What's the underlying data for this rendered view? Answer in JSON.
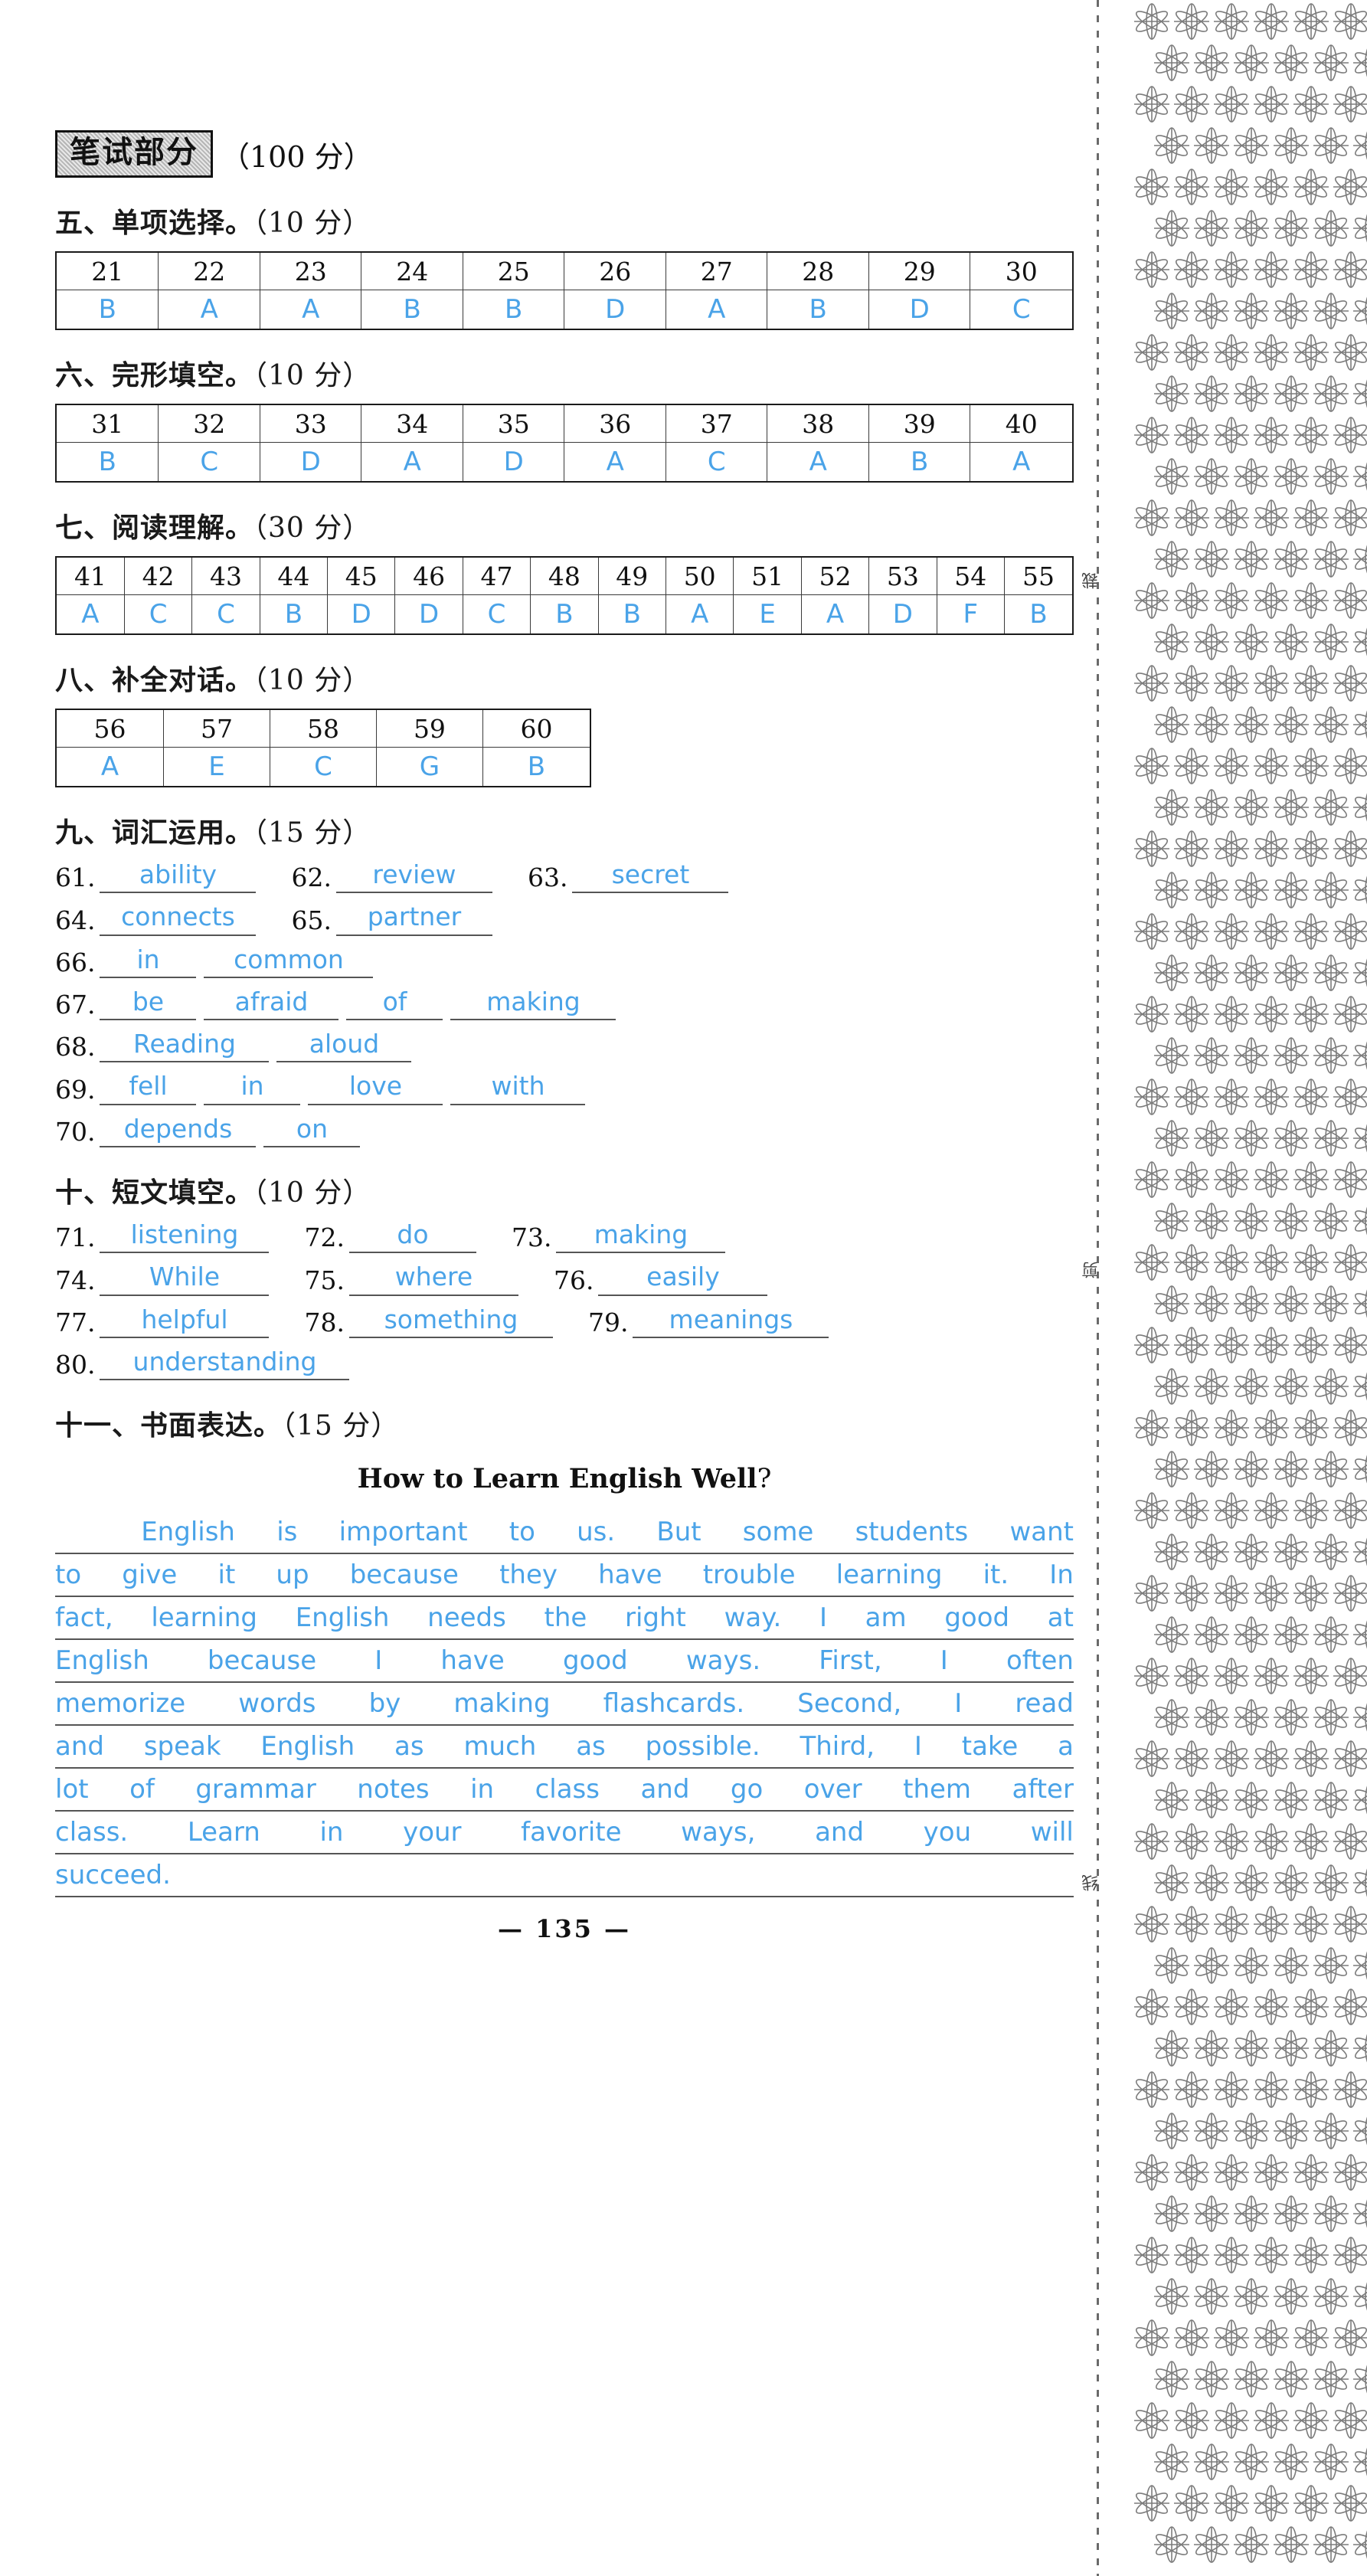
{
  "header": {
    "badge_label": "笔试部分",
    "badge_score": "（100 分）"
  },
  "sections": [
    {
      "heading_text": "五、单项选择。",
      "points": "（10 分）",
      "table": {
        "numbers": [
          "21",
          "22",
          "23",
          "24",
          "25",
          "26",
          "27",
          "28",
          "29",
          "30"
        ],
        "answers": [
          "B",
          "A",
          "A",
          "B",
          "B",
          "D",
          "A",
          "B",
          "D",
          "C"
        ]
      }
    },
    {
      "heading_text": "六、完形填空。",
      "points": "（10 分）",
      "table": {
        "numbers": [
          "31",
          "32",
          "33",
          "34",
          "35",
          "36",
          "37",
          "38",
          "39",
          "40"
        ],
        "answers": [
          "B",
          "C",
          "D",
          "A",
          "D",
          "A",
          "C",
          "A",
          "B",
          "A"
        ]
      }
    },
    {
      "heading_text": "七、阅读理解。",
      "points": "（30 分）",
      "table": {
        "numbers": [
          "41",
          "42",
          "43",
          "44",
          "45",
          "46",
          "47",
          "48",
          "49",
          "50",
          "51",
          "52",
          "53",
          "54",
          "55"
        ],
        "answers": [
          "A",
          "C",
          "C",
          "B",
          "D",
          "D",
          "C",
          "B",
          "B",
          "A",
          "E",
          "A",
          "D",
          "F",
          "B"
        ]
      }
    },
    {
      "heading_text": "八、补全对话。",
      "points": "（10 分）",
      "table": {
        "numbers": [
          "56",
          "57",
          "58",
          "59",
          "60"
        ],
        "answers": [
          "A",
          "E",
          "C",
          "G",
          "B"
        ]
      }
    }
  ],
  "vocabulary": {
    "heading_text": "九、词汇运用。",
    "points": "（15 分）",
    "rows": [
      [
        {
          "num": "61.",
          "words": [
            "ability"
          ],
          "widths": [
            188
          ]
        },
        {
          "num": "62.",
          "words": [
            "review"
          ],
          "widths": [
            188
          ]
        },
        {
          "num": "63.",
          "words": [
            "secret"
          ],
          "widths": [
            188
          ]
        }
      ],
      [
        {
          "num": "64.",
          "words": [
            "connects"
          ],
          "widths": [
            188
          ]
        },
        {
          "num": "65.",
          "words": [
            "partner"
          ],
          "widths": [
            188
          ]
        }
      ],
      [
        {
          "num": "66.",
          "words": [
            "in",
            "common"
          ],
          "widths": [
            110,
            205
          ]
        }
      ],
      [
        {
          "num": "67.",
          "words": [
            "be",
            "afraid",
            "of",
            "making"
          ],
          "widths": [
            110,
            160,
            110,
            200
          ]
        }
      ],
      [
        {
          "num": "68.",
          "words": [
            "Reading",
            "aloud"
          ],
          "widths": [
            205,
            160
          ]
        }
      ],
      [
        {
          "num": "69.",
          "words": [
            "fell",
            "in",
            "love",
            "with"
          ],
          "widths": [
            110,
            110,
            160,
            160
          ]
        }
      ],
      [
        {
          "num": "70.",
          "words": [
            "depends",
            "on"
          ],
          "widths": [
            188,
            110
          ]
        }
      ]
    ]
  },
  "cloze": {
    "heading_text": "十、短文填空。",
    "points": "（10 分）",
    "rows": [
      [
        {
          "num": "71.",
          "words": [
            "listening"
          ],
          "widths": [
            205
          ]
        },
        {
          "num": "72.",
          "words": [
            "do"
          ],
          "widths": [
            150
          ]
        },
        {
          "num": "73.",
          "words": [
            "making"
          ],
          "widths": [
            205
          ]
        }
      ],
      [
        {
          "num": "74.",
          "words": [
            "While"
          ],
          "widths": [
            205
          ]
        },
        {
          "num": "75.",
          "words": [
            "where"
          ],
          "widths": [
            205
          ]
        },
        {
          "num": "76.",
          "words": [
            "easily"
          ],
          "widths": [
            205
          ]
        }
      ],
      [
        {
          "num": "77.",
          "words": [
            "helpful"
          ],
          "widths": [
            205
          ]
        },
        {
          "num": "78.",
          "words": [
            "something"
          ],
          "widths": [
            250
          ]
        },
        {
          "num": "79.",
          "words": [
            "meanings"
          ],
          "widths": [
            240
          ]
        }
      ],
      [
        {
          "num": "80.",
          "words": [
            "understanding"
          ],
          "widths": [
            310
          ]
        }
      ]
    ]
  },
  "composition": {
    "heading_text": "十一、书面表达。",
    "points": "（15 分）",
    "title_main": "How to Learn English Well",
    "title_mark": "?",
    "lines": [
      "    English is important to us. But some students want",
      "to give it up because they have trouble learning it. In",
      "fact, learning English needs the right way. I am good at",
      "English because I have good ways. First, I often",
      "memorize words by making flashcards. Second, I read",
      "and speak English as much as possible. Third, I take a",
      "lot of grammar notes in class and go over them after",
      "class. Learn in your favorite ways, and you will",
      "succeed."
    ]
  },
  "footer": {
    "page_number": "— 135 —"
  },
  "decorations": {
    "cut_marks": [
      "裁",
      "剪",
      "线"
    ],
    "accent_color": "#4aa3e8"
  }
}
